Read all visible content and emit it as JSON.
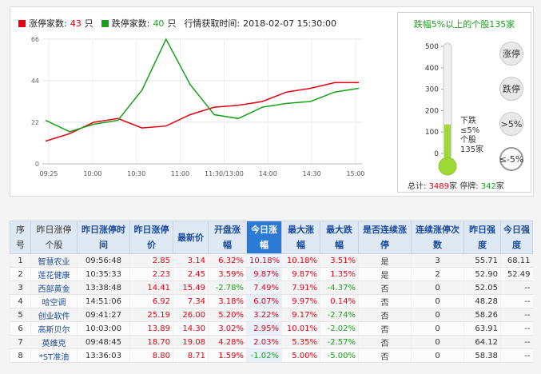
{
  "legend": {
    "limit_up_label": "涨停家数:",
    "limit_up_count": "43",
    "limit_down_label": "跌停家数:",
    "limit_down_count": "40",
    "unit": "只",
    "time_label": "行情获取时间:",
    "time_value": "2018-02-07 15:30:00"
  },
  "chart_data": {
    "type": "line",
    "x": [
      "09:25",
      "10:00",
      "10:30",
      "11:00",
      "11:30/13:00",
      "14:00",
      "14:30",
      "15:00"
    ],
    "yticks": [
      0,
      22,
      44,
      66
    ],
    "ylim": [
      0,
      66
    ],
    "series": [
      {
        "name": "涨停家数",
        "color": "#e60012",
        "values": [
          12,
          16,
          22,
          24,
          19,
          20,
          26,
          30,
          31,
          33,
          38,
          40,
          43,
          43
        ]
      },
      {
        "name": "跌停家数",
        "color": "#1aa01a",
        "values": [
          23,
          17,
          21,
          23,
          39,
          66,
          42,
          26,
          24,
          30,
          32,
          33,
          38,
          40
        ]
      }
    ],
    "grid": true
  },
  "thermo": {
    "title": "跌幅5%以上的个股135家",
    "scale": [
      "500",
      "400",
      "300",
      "200",
      "100",
      "0"
    ],
    "level": 135,
    "max": 500,
    "buttons": [
      "涨停",
      "跌停",
      ">5%",
      "≤-5%"
    ],
    "label_lines": [
      "下跌",
      "≤5%",
      "个股",
      "135家"
    ],
    "total_label": "总计:",
    "total_value": "3489",
    "total_unit": "家",
    "halt_label": "停牌:",
    "halt_value": "342",
    "halt_unit": "家"
  },
  "table": {
    "headers": [
      "序号",
      "昨日涨停个股",
      "昨日涨停时间",
      "昨日涨停价",
      "最新价",
      "开盘涨幅",
      "今日涨幅",
      "最大涨幅",
      "最大跌幅",
      "是否连续涨停",
      "连续涨停次数",
      "昨日强度",
      "今日强度"
    ],
    "rows": [
      [
        "1",
        "智慧农业",
        "09:56:48",
        "2.85",
        "3.14",
        "6.32%",
        "10.18%",
        "10.18%",
        "3.51%",
        "是",
        "3",
        "55.71",
        "68.11"
      ],
      [
        "2",
        "莲花健康",
        "10:35:33",
        "2.23",
        "2.45",
        "3.59%",
        "9.87%",
        "9.87%",
        "1.35%",
        "是",
        "2",
        "52.90",
        "52.49"
      ],
      [
        "3",
        "西部黄金",
        "13:38:48",
        "14.41",
        "15.49",
        "-2.78%",
        "7.49%",
        "7.91%",
        "-4.37%",
        "否",
        "0",
        "52.05",
        "--"
      ],
      [
        "4",
        "哈空调",
        "14:51:06",
        "6.92",
        "7.34",
        "3.18%",
        "6.07%",
        "9.97%",
        "0.14%",
        "否",
        "0",
        "48.28",
        "--"
      ],
      [
        "5",
        "创业软件",
        "09:41:27",
        "25.19",
        "26.00",
        "5.20%",
        "3.22%",
        "9.17%",
        "-2.74%",
        "否",
        "0",
        "58.26",
        "--"
      ],
      [
        "6",
        "高斯贝尔",
        "10:03:00",
        "13.89",
        "14.30",
        "3.02%",
        "2.95%",
        "10.01%",
        "-2.02%",
        "否",
        "0",
        "63.91",
        "--"
      ],
      [
        "7",
        "英维克",
        "09:48:45",
        "18.70",
        "19.08",
        "4.28%",
        "2.03%",
        "5.35%",
        "-2.57%",
        "否",
        "0",
        "64.12",
        "--"
      ],
      [
        "8",
        "*ST准油",
        "13:36:03",
        "8.80",
        "8.71",
        "1.59%",
        "-1.02%",
        "5.00%",
        "-5.00%",
        "否",
        "0",
        "58.38",
        "--"
      ]
    ]
  }
}
